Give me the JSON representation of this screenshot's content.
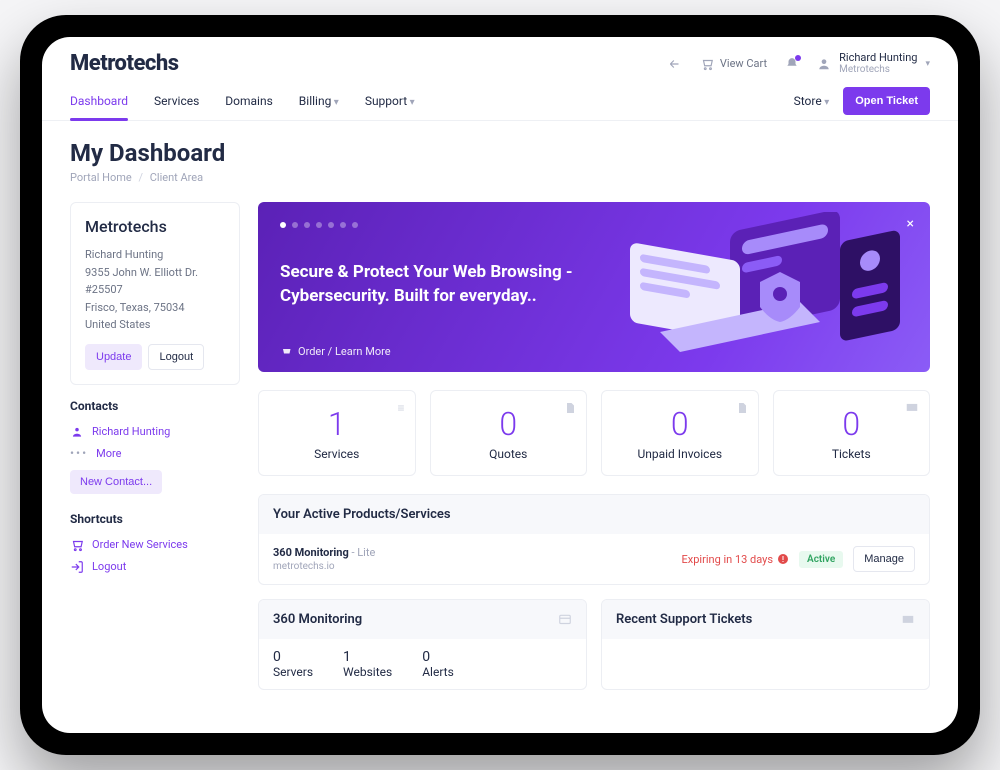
{
  "brand": "Metrotechs",
  "header": {
    "view_cart": "View Cart",
    "user_name": "Richard Hunting",
    "user_org": "Metrotechs"
  },
  "nav": {
    "items": [
      {
        "label": "Dashboard",
        "active": true
      },
      {
        "label": "Services"
      },
      {
        "label": "Domains"
      },
      {
        "label": "Billing",
        "drop": true
      },
      {
        "label": "Support",
        "drop": true
      }
    ],
    "store": "Store",
    "open_ticket": "Open Ticket"
  },
  "page": {
    "title": "My Dashboard",
    "crumb_home": "Portal Home",
    "crumb_current": "Client Area"
  },
  "account_card": {
    "company": "Metrotechs",
    "name": "Richard Hunting",
    "street": "9355 John W. Elliott Dr.",
    "unit": "#25507",
    "city": "Frisco, Texas, 75034",
    "country": "United States",
    "update": "Update",
    "logout": "Logout"
  },
  "contacts": {
    "heading": "Contacts",
    "primary": "Richard Hunting",
    "more": "More",
    "new": "New Contact..."
  },
  "shortcuts": {
    "heading": "Shortcuts",
    "order": "Order New Services",
    "logout": "Logout"
  },
  "banner": {
    "title": "Secure & Protect Your Web Browsing - Cybersecurity. Built for everyday..",
    "cta": "Order / Learn More"
  },
  "stats": [
    {
      "num": "1",
      "label": "Services"
    },
    {
      "num": "0",
      "label": "Quotes"
    },
    {
      "num": "0",
      "label": "Unpaid Invoices"
    },
    {
      "num": "0",
      "label": "Tickets"
    }
  ],
  "active_products": {
    "heading": "Your Active Products/Services",
    "product_name": "360 Monitoring",
    "product_plan": " - Lite",
    "product_host": "metrotechs.io",
    "expiring": "Expiring in 13 days",
    "status": "Active",
    "manage": "Manage"
  },
  "monitoring_panel": {
    "heading": "360 Monitoring",
    "cells": [
      {
        "v": "0",
        "l": "Servers"
      },
      {
        "v": "1",
        "l": "Websites"
      },
      {
        "v": "0",
        "l": "Alerts"
      }
    ]
  },
  "tickets_panel": {
    "heading": "Recent Support Tickets"
  }
}
